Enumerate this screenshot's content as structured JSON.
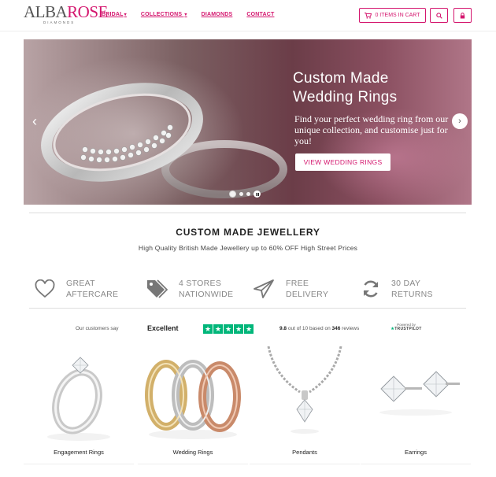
{
  "brand": {
    "name_part1": "ALBA",
    "name_part2": "ROSE",
    "tagline": "DIAMONDS"
  },
  "nav": {
    "items": [
      {
        "label": "BRIDAL",
        "has_dropdown": true
      },
      {
        "label": "COLLECTIONS",
        "has_dropdown": true
      },
      {
        "label": "DIAMONDS",
        "has_dropdown": false
      },
      {
        "label": "CONTACT",
        "has_dropdown": false
      }
    ],
    "dropdown_caret": "▾"
  },
  "header_actions": {
    "cart_label": "0 ITEMS IN CART",
    "cart_icon": "cart-icon",
    "search_icon": "search-icon",
    "account_icon": "lock-icon"
  },
  "hero": {
    "title": "Custom Made Wedding Rings",
    "text": "Find your perfect wedding ring from our unique collection, and customise just for you!",
    "button_label": "VIEW WEDDING RINGS",
    "prev_arrow": "‹",
    "next_arrow": "›",
    "slides_count": 3,
    "active_slide": 1
  },
  "intro": {
    "title": "CUSTOM MADE JEWELLERY",
    "subtitle": "High Quality British Made Jewellery up to 60% OFF High Street Prices"
  },
  "features": [
    {
      "line1": "GREAT",
      "line2": "AFTERCARE",
      "icon": "heart-icon"
    },
    {
      "line1": "4 STORES",
      "line2": "NATIONWIDE",
      "icon": "tags-icon"
    },
    {
      "line1": "FREE",
      "line2": "DELIVERY",
      "icon": "paper-plane-icon"
    },
    {
      "line1": "30 DAY",
      "line2": "RETURNS",
      "icon": "refresh-icon"
    }
  ],
  "trustpilot": {
    "customers_say": "Our customers say",
    "rating_word": "Excellent",
    "stars": 5,
    "star_glyph": "★",
    "score": "9.8",
    "score_mid": " out of 10 based on ",
    "review_count": "346",
    "score_tail": " reviews",
    "powered_by": "Powered by",
    "provider": "TRUSTPILOT",
    "star_color": "#00b67a"
  },
  "products": [
    {
      "label": "Engagement Rings",
      "icon": "engagement-ring-image"
    },
    {
      "label": "Wedding Rings",
      "icon": "wedding-bands-image"
    },
    {
      "label": "Pendants",
      "icon": "pendant-image"
    },
    {
      "label": "Earrings",
      "icon": "earrings-image"
    }
  ],
  "colors": {
    "brand_pink": "#d4166e",
    "text_grey": "#888888"
  }
}
